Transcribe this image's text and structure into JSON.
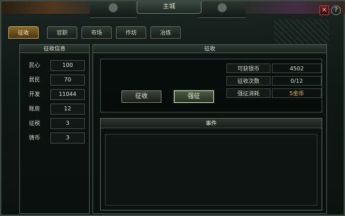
{
  "window": {
    "title": "主城"
  },
  "controls": {
    "close_label": "×",
    "help_label": "?"
  },
  "tabs": [
    {
      "label": "征收",
      "active": true
    },
    {
      "label": "官职",
      "active": false
    },
    {
      "label": "市场",
      "active": false
    },
    {
      "label": "作坊",
      "active": false
    },
    {
      "label": "冶炼",
      "active": false
    }
  ],
  "left_panel": {
    "title": "征收信息",
    "stats": [
      {
        "label": "民心",
        "value": "100"
      },
      {
        "label": "居民",
        "value": "70"
      },
      {
        "label": "开发",
        "value": "11044"
      },
      {
        "label": "账房",
        "value": "12"
      },
      {
        "label": "征税",
        "value": "3"
      },
      {
        "label": "铸币",
        "value": "3"
      }
    ]
  },
  "main_panel": {
    "title": "征收",
    "buttons": {
      "collect": "征收",
      "force_collect": "强征"
    },
    "info": [
      {
        "label": "可获银币",
        "value": "4502"
      },
      {
        "label": "征收次数",
        "value": "0/12"
      },
      {
        "label": "强征消耗",
        "value": "5金币"
      }
    ],
    "events_title": "事件"
  },
  "colors": {
    "active_tab": "#8a6a2a",
    "gold_text": "#f0c040",
    "border": "#4a5a50"
  }
}
